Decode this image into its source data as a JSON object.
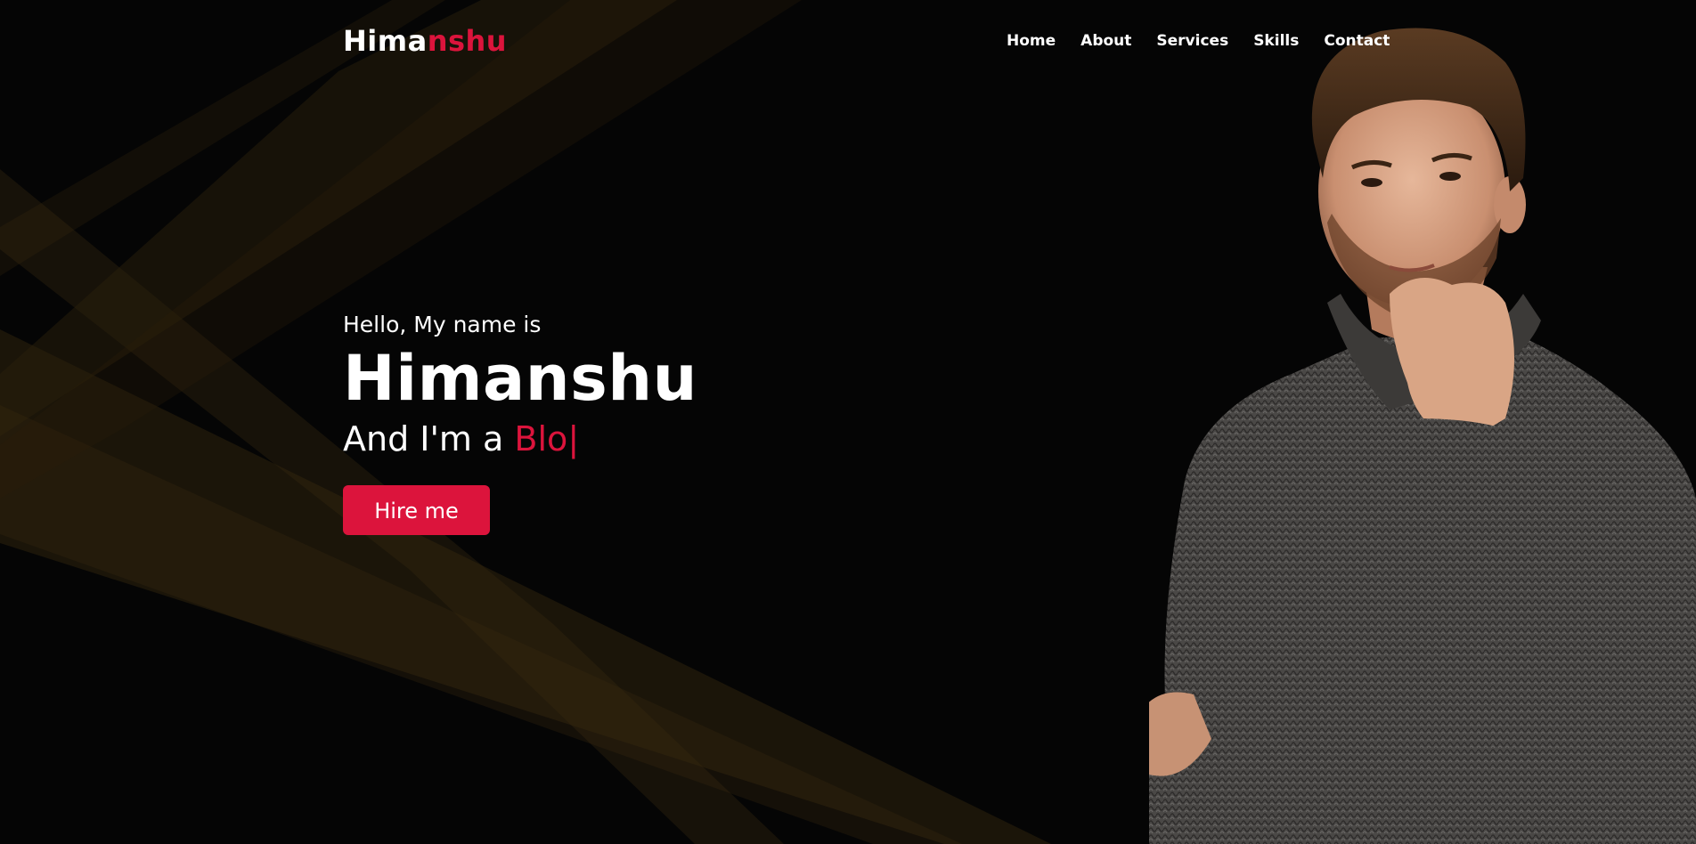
{
  "header": {
    "logo_primary": "Hima",
    "logo_accent": "nshu",
    "nav": [
      "Home",
      "About",
      "Services",
      "Skills",
      "Contact"
    ]
  },
  "hero": {
    "greeting": "Hello, My name is",
    "name": "Himanshu",
    "role_prefix": "And I'm a",
    "role_typed": "Blo",
    "cursor": "|",
    "cta_label": "Hire me"
  },
  "colors": {
    "accent": "#dc143c",
    "background": "#050505",
    "beam": "#3a2a10"
  },
  "icons": {
    "portrait": "man-in-grey-sweater-portrait"
  }
}
